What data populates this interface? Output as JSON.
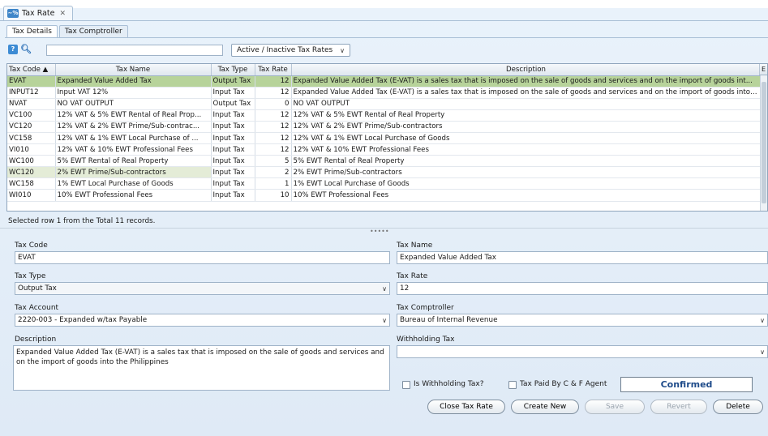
{
  "window": {
    "tab_title": "Tax Rate",
    "tab_icon": "tax-rate-icon"
  },
  "tabs": [
    "Tax Details",
    "Tax Comptroller"
  ],
  "toolbar": {
    "search_placeholder": "",
    "filter_selected": "Active / Inactive Tax Rates"
  },
  "table": {
    "columns": [
      "Tax Code ▲",
      "Tax Name",
      "Tax Type",
      "Tax Rate",
      "Description",
      "E"
    ],
    "rows": [
      [
        "EVAT",
        "Expanded Value Added Tax",
        "Output Tax",
        "12",
        "Expanded Value Added Tax (E-VAT) is a sales tax that is imposed on the sale of goods and services and on the import of goods int..."
      ],
      [
        "INPUT12",
        "Input VAT 12%",
        "Input Tax",
        "12",
        "Expanded Value Added Tax (E-VAT) is a sales tax that is imposed on the sale of goods and services and on the import of goods into the Philippines"
      ],
      [
        "NVAT",
        "NO VAT OUTPUT",
        "Output Tax",
        "0",
        "NO VAT OUTPUT"
      ],
      [
        "VC100",
        "12% VAT & 5% EWT Rental of Real Prop...",
        "Input Tax",
        "12",
        "12% VAT & 5% EWT Rental of Real Property"
      ],
      [
        "VC120",
        "12% VAT & 2% EWT Prime/Sub-contrac...",
        "Input Tax",
        "12",
        "12% VAT & 2% EWT Prime/Sub-contractors"
      ],
      [
        "VC158",
        "12% VAT & 1% EWT Local Purchase of ...",
        "Input Tax",
        "12",
        "12% VAT & 1% EWT Local Purchase of Goods"
      ],
      [
        "VI010",
        "12% VAT & 10% EWT Professional Fees",
        "Input Tax",
        "12",
        "12% VAT & 10% EWT Professional Fees"
      ],
      [
        "WC100",
        "5% EWT Rental of Real Property",
        "Input Tax",
        "5",
        "5% EWT Rental of Real Property"
      ],
      [
        "WC120",
        "2% EWT Prime/Sub-contractors",
        "Input Tax",
        "2",
        "2% EWT Prime/Sub-contractors"
      ],
      [
        "WC158",
        "1% EWT Local Purchase of Goods",
        "Input Tax",
        "1",
        "1% EWT Local Purchase of Goods"
      ],
      [
        "WI010",
        "10% EWT Professional Fees",
        "Input Tax",
        "10",
        "10% EWT Professional Fees"
      ]
    ],
    "selected_row": 0,
    "hover_row": 8
  },
  "status_text": "Selected row 1 from the Total 11 records.",
  "form": {
    "tax_code_label": "Tax Code",
    "tax_code_value": "EVAT",
    "tax_name_label": "Tax Name",
    "tax_name_value": "Expanded Value Added Tax",
    "tax_type_label": "Tax Type",
    "tax_type_value": "Output Tax",
    "tax_rate_label": "Tax Rate",
    "tax_rate_value": "12",
    "tax_account_label": "Tax Account",
    "tax_account_value": "2220-003 - Expanded w/tax Payable",
    "tax_comptroller_label": "Tax Comptroller",
    "tax_comptroller_value": "Bureau of Internal Revenue",
    "description_label": "Description",
    "description_value": "Expanded Value Added Tax (E-VAT) is a sales tax that is imposed on the sale of goods and services and on the import of goods into the Philippines",
    "withholding_tax_label": "Withholding Tax",
    "withholding_tax_value": "",
    "is_withholding_label": "Is Withholding Tax?",
    "tax_paid_label": "Tax Paid By C & F Agent",
    "status_value": "Confirmed"
  },
  "buttons": {
    "close": "Close Tax Rate",
    "create": "Create New",
    "save": "Save",
    "revert": "Revert",
    "delete": "Delete"
  }
}
